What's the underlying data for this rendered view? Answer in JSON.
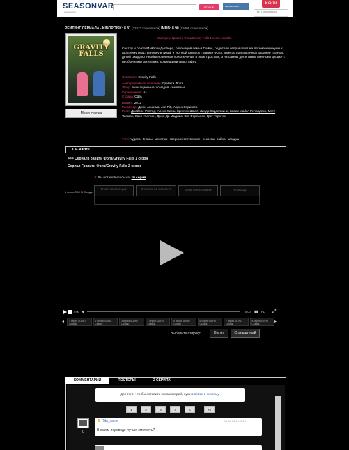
{
  "header": {
    "logo_main": "SEASONVAR",
    "logo_sub": "seasonvar.ru",
    "search_button": "ПОИСК",
    "vk_label": "Мы ВКонтакте",
    "login_button": "Войти",
    "where_stopped": "Где я остановился"
  },
  "rating": {
    "label": "РЕЙТИНГ СЕРИАЛА - KINOPOISK: 8.81",
    "kp_votes": "(22522 голосовали)",
    "imdb": "IMDB: 8.90",
    "imdb_votes": "(19405 голосовали)"
  },
  "poster": {
    "title_art": "GRAVITY FALLS"
  },
  "season_menu": "Меню сезона",
  "watch_title": "Смотреть Гравити Фолз/Gravity Falls 1 сезон онлайн",
  "description": "Сестру и брата Мэйбл и Диппера, близнецов семьи Пайнс, родители отправляют на летние каникулы к дальнему родственнику в тихий и уютный городок Гравити Фолз. Вместо придуманных заранее планов, детей ожидают необыкновенные приключения в этом простом, а на самом деле таинственном городке с необычными жителями, хранящими свою тайну.",
  "info": {
    "original_label": "Оригинал:",
    "original_value": "Gravity Falls",
    "alt_title_label": "Альтернативное название:",
    "alt_title_value": "Гравити Фолз",
    "genre_label": "Жанр:",
    "genre_value": "анимационные, комедия, семейные",
    "age_label": "Ограничение:",
    "age_value": "6+",
    "country_label": "Страна:",
    "country_value": "США",
    "year_label": "Вышел:",
    "year_value": "2012",
    "director_label": "Режиссёр:",
    "director_value": "Джон Аошима, Joe Pitt, Аарон Спрингер",
    "cast_label": "Роли:",
    "cast_value": "Джейсон Риттер, Алекс Хирш, Кристен Шаал, Линда Карделлини, Кевин Майкл Ричардсон, Мэтт Чапман, Кари Уолгрен, Джон Ди Маджио, Кит Фергюсон, Грег Торнтон"
  },
  "tags": {
    "label": "Тэги:",
    "items": [
      "чудеса",
      "Гномы",
      "монстры",
      "сверхъестественное",
      "секреты",
      "тайна",
      "загадка"
    ]
  },
  "seasons": {
    "header": "СЕЗОНЫ",
    "items": [
      ">>> Сериал Гравити Фолз/Gravity Falls 1 сезон",
      "Сериал Гравити Фолз/Gravity Falls 2 сезон"
    ]
  },
  "stopped": {
    "prefix": "Вы остановились на:",
    "episode": "10 серия"
  },
  "quality_note": "1 серия SD/HD Сьюдж",
  "player_tabs": [
    {
      "label": "Отметка на серии",
      "single": false
    },
    {
      "label": "Отметка на моменте",
      "single": false
    },
    {
      "label": "Блок телесериала",
      "single": true
    },
    {
      "label": "НТМЕщь!",
      "single": true
    }
  ],
  "controls": {
    "time_left": "0:00",
    "time_right": "0:00",
    "quality": "HD"
  },
  "playlist": [
    "1 серия SD/HD Сьюдж",
    "2 серия SD/HD Сьюдж",
    "3 серия SD/HD Сьюдж",
    "4 серия SD/HD Сьюдж",
    "5 серия SD/HD Сьюдж",
    "6 серия SD/HD Сьюдж",
    "7 серия SD/HD Сьюдж",
    "8 серия SD/HD Сьюдж"
  ],
  "dubbing": {
    "label": "Выберите озвучку:",
    "options": [
      "Disney",
      "Стандартный"
    ]
  },
  "comments": {
    "tabs": [
      "КОММЕНТАРИИ",
      "ПОСТЕРЫ",
      "О СЕРИЯХ"
    ],
    "login_notice_prefix": "Для того, что бы оставить комментарий, нужно",
    "login_notice_link": "войти в систему",
    "pages": [
      "1",
      "2",
      "3",
      "4",
      "5",
      "78"
    ],
    "first": {
      "author": "Rita_xaker",
      "date": "11:48 16.10.2016",
      "score": "0",
      "text": "В каком переводе лучше смотреть?"
    }
  }
}
